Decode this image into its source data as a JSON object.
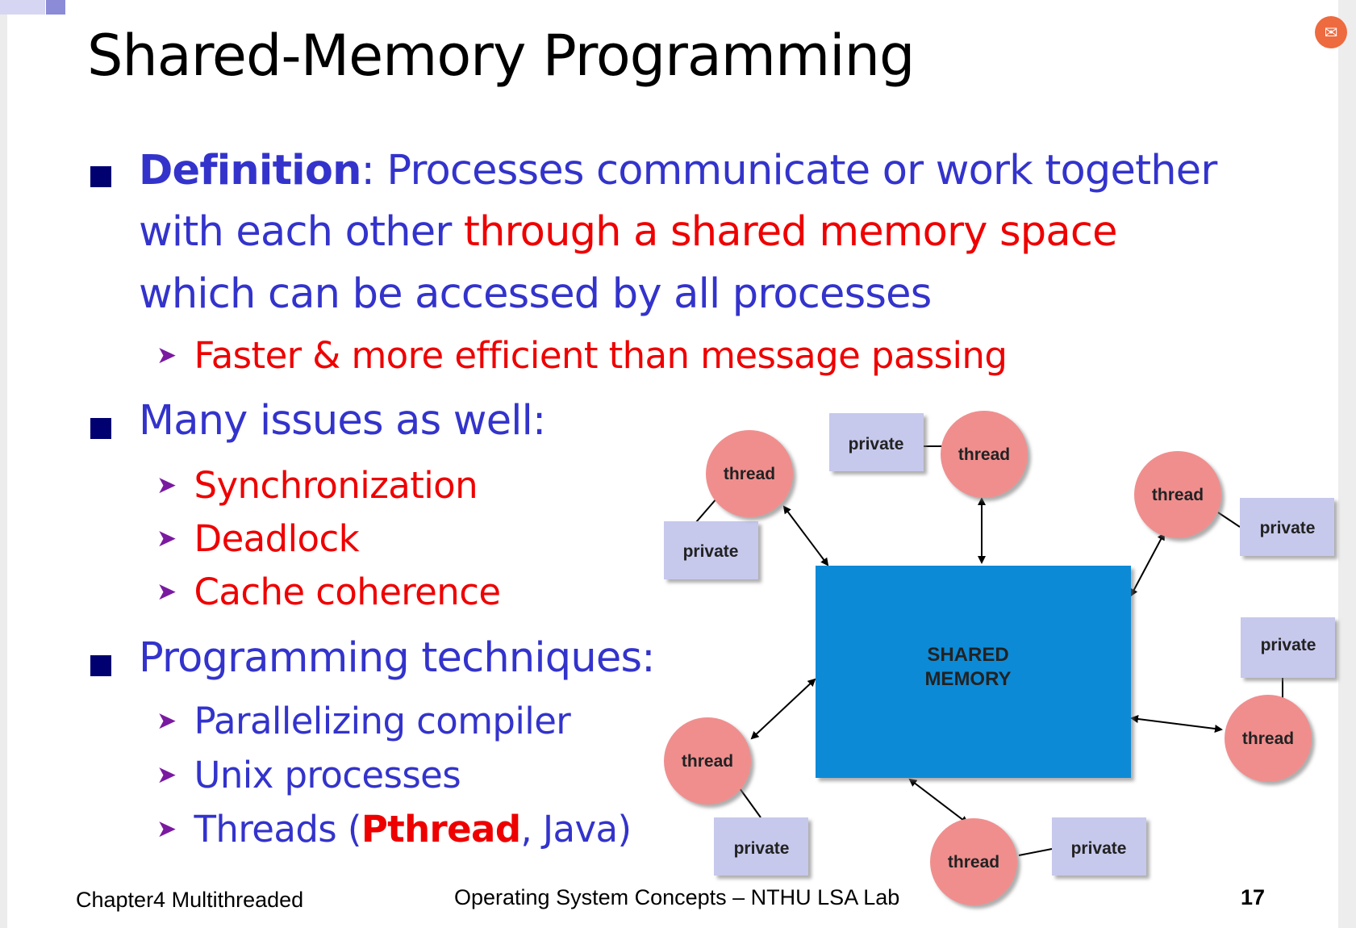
{
  "title": "Shared-Memory Programming",
  "badge_icon": "chat-icon",
  "bullets": {
    "definition": {
      "term": "Definition",
      "line1_rest": ": Processes communicate or work together",
      "line2_a": "with each other ",
      "line2_red": "through a shared memory space",
      "line3": "which can be accessed by all processes",
      "sub": "Faster & more efficient than message passing"
    },
    "issues": {
      "heading": "Many issues as well:",
      "items": [
        "Synchronization",
        "Deadlock",
        "Cache coherence"
      ]
    },
    "techniques": {
      "heading": "Programming techniques:",
      "items": [
        "Parallelizing compiler",
        "Unix processes"
      ],
      "threads_a": "Threads (",
      "threads_bold": "Pthread",
      "threads_b": ", Java)"
    }
  },
  "diagram": {
    "center_line1": "SHARED",
    "center_line2": "MEMORY",
    "thread_label": "thread",
    "private_label": "private",
    "colors": {
      "memory": "#0a8ad6",
      "thread": "#f08e8e",
      "private": "#c6c8ec"
    }
  },
  "footer": {
    "left": "Chapter4 Multithreaded",
    "center": "Operating System Concepts – NTHU LSA Lab",
    "page": "17"
  }
}
